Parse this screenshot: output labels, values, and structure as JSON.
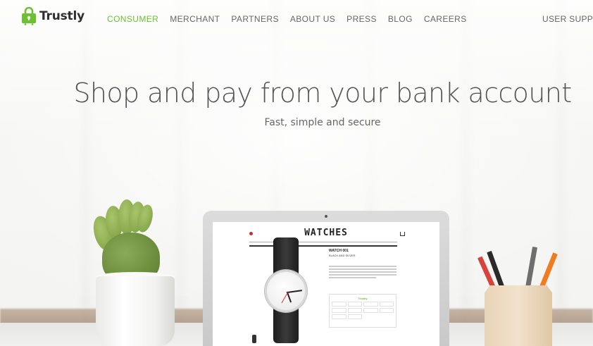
{
  "brand": {
    "name": "Trustly",
    "accent_color": "#6cc12f",
    "logo_icon": "lock-bag-icon"
  },
  "nav": {
    "items": [
      {
        "label": "CONSUMER",
        "active": true
      },
      {
        "label": "MERCHANT",
        "active": false
      },
      {
        "label": "PARTNERS",
        "active": false
      },
      {
        "label": "ABOUT US",
        "active": false
      },
      {
        "label": "PRESS",
        "active": false
      },
      {
        "label": "BLOG",
        "active": false
      },
      {
        "label": "CAREERS",
        "active": false
      }
    ],
    "user_support": "USER SUPPORT"
  },
  "hero": {
    "headline": "Shop and pay from your bank account",
    "subhead": "Fast, simple and secure"
  },
  "laptop_screen": {
    "store_title": "WATCHES",
    "product_heading": "WATCH 001",
    "product_sub": "BLACK AND SILVER"
  }
}
